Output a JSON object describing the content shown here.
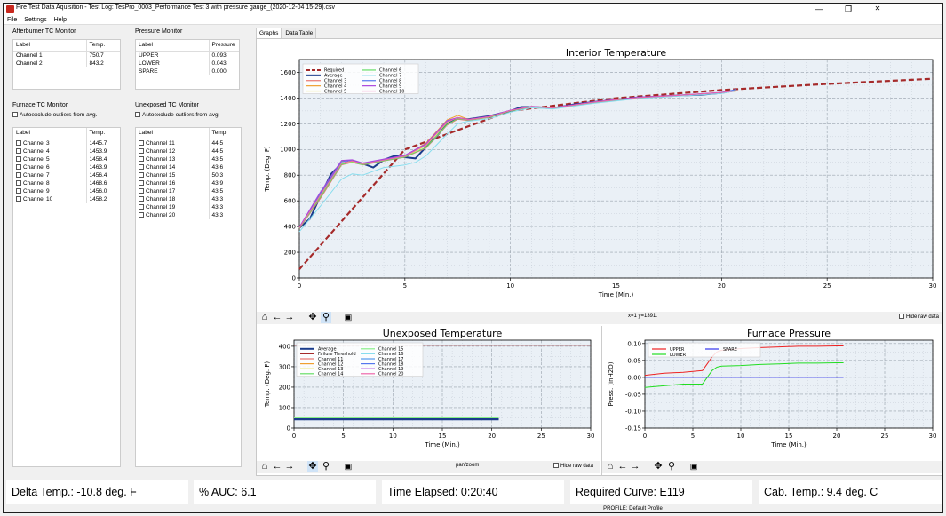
{
  "window": {
    "title": "Fire Test Data Aquisition - Test Log: TesPro_0003_Performance Test 3 with pressure gauge_(2020-12-04 15-29).csv",
    "minimize": "—",
    "maximize": "❐",
    "close": "✕"
  },
  "menu": [
    "File",
    "Settings",
    "Help"
  ],
  "afterburner": {
    "title": "Afterburner TC Monitor",
    "headers": [
      "Label",
      "Temp."
    ],
    "rows": [
      [
        "Channel 1",
        "750.7"
      ],
      [
        "Channel 2",
        "843.2"
      ]
    ]
  },
  "pressure_monitor": {
    "title": "Pressure Monitor",
    "headers": [
      "Label",
      "Pressure"
    ],
    "rows": [
      [
        "UPPER",
        "0.093"
      ],
      [
        "LOWER",
        "0.043"
      ],
      [
        "SPARE",
        "0.000"
      ]
    ]
  },
  "furnace_tc": {
    "title": "Furnace TC Monitor",
    "autoexclude": "Autoexclude outliers from avg.",
    "headers": [
      "Label",
      "Temp."
    ],
    "rows": [
      [
        "Channel 3",
        "1445.7"
      ],
      [
        "Channel 4",
        "1453.9"
      ],
      [
        "Channel 5",
        "1458.4"
      ],
      [
        "Channel 6",
        "1463.9"
      ],
      [
        "Channel 7",
        "1456.4"
      ],
      [
        "Channel 8",
        "1468.6"
      ],
      [
        "Channel 9",
        "1456.0"
      ],
      [
        "Channel 10",
        "1458.2"
      ]
    ]
  },
  "unexposed_tc": {
    "title": "Unexposed TC Monitor",
    "autoexclude": "Autoexclude outliers from avg.",
    "headers": [
      "Label",
      "Temp."
    ],
    "rows": [
      [
        "Channel 11",
        "44.5"
      ],
      [
        "Channel 12",
        "44.5"
      ],
      [
        "Channel 13",
        "43.5"
      ],
      [
        "Channel 14",
        "43.6"
      ],
      [
        "Channel 15",
        "50.3"
      ],
      [
        "Channel 16",
        "43.9"
      ],
      [
        "Channel 17",
        "43.5"
      ],
      [
        "Channel 18",
        "43.3"
      ],
      [
        "Channel 19",
        "43.3"
      ],
      [
        "Channel 20",
        "43.3"
      ]
    ]
  },
  "tabs": [
    "Graphs",
    "Data Table"
  ],
  "toolbar1": {
    "coords": "x=1 y=1391.",
    "hide_raw": "Hide raw data"
  },
  "toolbar2": {
    "mode": "pan/zoom",
    "hide_raw": "Hide raw data"
  },
  "toolbar_icons": [
    "home-icon",
    "back-arrow-icon",
    "forward-arrow-icon",
    "pan-icon",
    "zoom-icon",
    "save-icon"
  ],
  "status": {
    "delta": "Delta Temp.: -10.8 deg. F",
    "auc": "% AUC: 6.1",
    "elapsed": "Time Elapsed: 0:20:40",
    "curve": "Required Curve: E119",
    "cab": "Cab. Temp.: 9.4 deg. C"
  },
  "profile": "PROFILE: Default Profile",
  "chart_data": [
    {
      "type": "line",
      "title": "Interior Temperature",
      "xlabel": "Time (Min.)",
      "ylabel": "Temp. (Deg. F)",
      "xlim": [
        0,
        30
      ],
      "ylim": [
        0,
        1700
      ],
      "xticks": [
        0,
        5,
        10,
        15,
        20,
        25,
        30
      ],
      "yticks": [
        0,
        200,
        400,
        600,
        800,
        1000,
        1200,
        1400,
        1600
      ],
      "grid": true,
      "legend": "top-left",
      "legend_entries": [
        "Required",
        "Average",
        "Channel 3",
        "Channel 4",
        "Channel 5",
        "Channel 6",
        "Channel 7",
        "Channel 8",
        "Channel 9",
        "Channel 10"
      ],
      "colors": {
        "Required": "#a52a2a",
        "Average": "#1a3c8c",
        "Channel 3": "#e8746e",
        "Channel 4": "#f0a030",
        "Channel 5": "#e8e060",
        "Channel 6": "#66dd66",
        "Channel 7": "#88ddee",
        "Channel 8": "#5577ee",
        "Channel 9": "#aa44dd",
        "Channel 10": "#ee66aa"
      },
      "series": [
        {
          "name": "Required",
          "x": [
            0,
            5,
            10,
            15,
            20,
            25,
            30
          ],
          "y": [
            68,
            1000,
            1300,
            1399,
            1462,
            1510,
            1550
          ]
        },
        {
          "name": "Average",
          "x": [
            0,
            0.5,
            1,
            1.5,
            2,
            2.5,
            3,
            3.5,
            4,
            4.5,
            5,
            5.5,
            6,
            6.5,
            7,
            7.5,
            8,
            9,
            10,
            10.5,
            11,
            12,
            13,
            14,
            15,
            16,
            17,
            18,
            19,
            20,
            20.7
          ],
          "y": [
            390,
            460,
            640,
            810,
            890,
            910,
            890,
            860,
            920,
            950,
            940,
            930,
            1020,
            1100,
            1200,
            1240,
            1235,
            1260,
            1300,
            1330,
            1330,
            1320,
            1350,
            1370,
            1385,
            1405,
            1410,
            1420,
            1425,
            1440,
            1460
          ]
        },
        {
          "name": "Channel 3",
          "x": [
            0,
            1,
            2,
            2.5,
            3,
            4,
            5,
            6,
            7,
            7.5,
            8,
            9,
            10,
            11,
            12,
            14,
            16,
            18,
            20,
            20.7
          ],
          "y": [
            385,
            620,
            880,
            900,
            880,
            910,
            940,
            1010,
            1190,
            1235,
            1225,
            1250,
            1300,
            1330,
            1320,
            1365,
            1400,
            1420,
            1440,
            1456
          ]
        },
        {
          "name": "Channel 4",
          "x": [
            0,
            1,
            2,
            2.5,
            3,
            4,
            5,
            6,
            7,
            7.5,
            8,
            9,
            10,
            11,
            12,
            14,
            16,
            18,
            20,
            20.7
          ],
          "y": [
            395,
            650,
            910,
            915,
            890,
            920,
            950,
            1050,
            1230,
            1265,
            1235,
            1255,
            1305,
            1335,
            1325,
            1370,
            1405,
            1422,
            1442,
            1454
          ]
        },
        {
          "name": "Channel 5",
          "x": [
            0,
            1,
            2,
            2.5,
            3,
            4,
            5,
            6,
            7,
            7.5,
            8,
            9,
            10,
            11,
            12,
            14,
            16,
            18,
            20,
            20.7
          ],
          "y": [
            390,
            640,
            890,
            905,
            885,
            915,
            945,
            1030,
            1210,
            1250,
            1230,
            1252,
            1302,
            1332,
            1322,
            1368,
            1402,
            1421,
            1441,
            1458
          ]
        },
        {
          "name": "Channel 6",
          "x": [
            0,
            1,
            2,
            2.5,
            3,
            4,
            5,
            6,
            7,
            7.5,
            8,
            9,
            10,
            11,
            12,
            14,
            16,
            18,
            20,
            20.7
          ],
          "y": [
            388,
            630,
            885,
            900,
            882,
            912,
            942,
            1015,
            1195,
            1240,
            1228,
            1251,
            1300,
            1330,
            1322,
            1366,
            1401,
            1420,
            1440,
            1464
          ]
        },
        {
          "name": "Channel 7",
          "x": [
            0,
            1,
            2,
            2.5,
            3,
            4,
            5,
            5.5,
            6,
            7,
            7.5,
            8,
            9,
            10,
            11,
            12,
            14,
            16,
            18,
            20,
            20.7
          ],
          "y": [
            360,
            560,
            770,
            810,
            800,
            860,
            880,
            900,
            950,
            1120,
            1200,
            1220,
            1240,
            1290,
            1325,
            1315,
            1360,
            1395,
            1415,
            1435,
            1456
          ]
        },
        {
          "name": "Channel 8",
          "x": [
            0,
            1,
            2,
            2.5,
            3,
            4,
            5,
            6,
            7,
            7.5,
            8,
            9,
            10,
            11,
            12,
            14,
            16,
            18,
            20,
            20.7
          ],
          "y": [
            392,
            660,
            905,
            918,
            892,
            922,
            952,
            1040,
            1220,
            1245,
            1232,
            1256,
            1304,
            1334,
            1324,
            1369,
            1404,
            1422,
            1443,
            1468
          ]
        },
        {
          "name": "Channel 9",
          "x": [
            0,
            1,
            2,
            2.5,
            3,
            4,
            5,
            6,
            7,
            7.5,
            8,
            9,
            10,
            11,
            12,
            14,
            16,
            18,
            20,
            20.7
          ],
          "y": [
            396,
            670,
            915,
            920,
            895,
            925,
            955,
            1045,
            1225,
            1248,
            1234,
            1258,
            1306,
            1336,
            1326,
            1371,
            1406,
            1423,
            1444,
            1456
          ]
        },
        {
          "name": "Channel 10",
          "x": [
            0,
            1,
            2,
            2.5,
            3,
            4,
            5,
            6,
            7,
            7.5,
            8,
            9,
            10,
            11,
            12,
            14,
            16,
            18,
            20,
            20.7
          ],
          "y": [
            391,
            645,
            895,
            910,
            888,
            918,
            948,
            1035,
            1215,
            1245,
            1231,
            1254,
            1303,
            1333,
            1323,
            1368,
            1403,
            1421,
            1442,
            1458
          ]
        }
      ]
    },
    {
      "type": "line",
      "title": "Unexposed Temperature",
      "xlabel": "Time (Min.)",
      "ylabel": "Temp. (Deg. F)",
      "xlim": [
        0,
        30
      ],
      "ylim": [
        0,
        430
      ],
      "xticks": [
        0,
        5,
        10,
        15,
        20,
        25,
        30
      ],
      "yticks": [
        0,
        100,
        200,
        300,
        400
      ],
      "grid": true,
      "legend": "top-left",
      "legend_entries": [
        "Average",
        "Failure Threshold",
        "Channel 11",
        "Channel 12",
        "Channel 13",
        "Channel 14",
        "Channel 15",
        "Channel 16",
        "Channel 17",
        "Channel 18",
        "Channel 19",
        "Channel 20"
      ],
      "colors": {
        "Average": "#1a3c8c",
        "Failure Threshold": "#a52a2a",
        "Channel 11": "#e8746e",
        "Channel 12": "#f0a030",
        "Channel 13": "#e8e060",
        "Channel 14": "#66dd66",
        "Channel 15": "#88ee88",
        "Channel 16": "#88ddee",
        "Channel 17": "#5599ee",
        "Channel 18": "#5577ee",
        "Channel 19": "#aa44dd",
        "Channel 20": "#ee66aa"
      },
      "series": [
        {
          "name": "Failure Threshold",
          "x": [
            0,
            30
          ],
          "y": [
            405,
            405
          ]
        },
        {
          "name": "Average",
          "x": [
            0,
            20.7
          ],
          "y": [
            44,
            44
          ]
        },
        {
          "name": "Channel 15",
          "x": [
            0,
            20.7
          ],
          "y": [
            50,
            50
          ]
        }
      ]
    },
    {
      "type": "line",
      "title": "Furnace Pressure",
      "xlabel": "Time (Min.)",
      "ylabel": "Press. (inH2O)",
      "xlim": [
        0,
        30
      ],
      "ylim": [
        -0.15,
        0.11
      ],
      "xticks": [
        0,
        5,
        10,
        15,
        20,
        25,
        30
      ],
      "yticks": [
        -0.15,
        -0.1,
        -0.05,
        0.0,
        0.05,
        0.1
      ],
      "grid": true,
      "legend": "top-left",
      "legend_entries": [
        "UPPER",
        "LOWER",
        "SPARE"
      ],
      "colors": {
        "UPPER": "#ee2222",
        "LOWER": "#22dd22",
        "SPARE": "#3333ee"
      },
      "series": [
        {
          "name": "UPPER",
          "x": [
            0,
            2,
            4,
            6,
            6.5,
            7,
            7.5,
            8,
            10,
            12,
            14,
            16,
            18,
            20,
            20.7
          ],
          "y": [
            0.006,
            0.012,
            0.015,
            0.02,
            0.04,
            0.06,
            0.075,
            0.08,
            0.085,
            0.088,
            0.09,
            0.092,
            0.092,
            0.093,
            0.093
          ]
        },
        {
          "name": "LOWER",
          "x": [
            0,
            2,
            4,
            6,
            6.5,
            7,
            7.5,
            8,
            10,
            12,
            14,
            16,
            18,
            20,
            20.7
          ],
          "y": [
            -0.03,
            -0.025,
            -0.02,
            -0.02,
            0.0,
            0.02,
            0.03,
            0.033,
            0.035,
            0.038,
            0.04,
            0.042,
            0.042,
            0.043,
            0.043
          ]
        },
        {
          "name": "SPARE",
          "x": [
            0,
            20.7
          ],
          "y": [
            0,
            0
          ]
        }
      ]
    }
  ]
}
